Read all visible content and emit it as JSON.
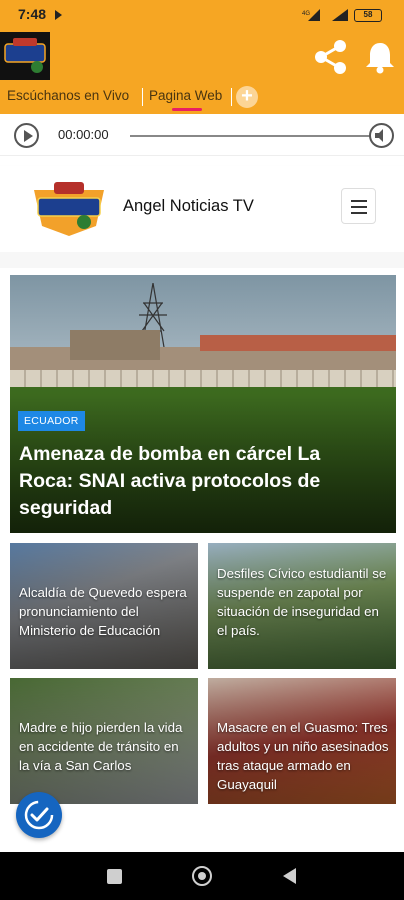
{
  "status_bar": {
    "time": "7:48",
    "battery": "58",
    "network": "4G"
  },
  "app_bar": {
    "logo_icon": "angel-noticias-logo",
    "share_icon": "share-icon",
    "bell_icon": "bell-icon"
  },
  "tabs": [
    {
      "label": "Escúchanos en Vivo"
    },
    {
      "label": "Pagina Web"
    }
  ],
  "player": {
    "time": "00:00:00"
  },
  "site": {
    "title": "Angel Noticias TV"
  },
  "hero": {
    "category": "ECUADOR",
    "headline": "Amenaza de bomba en cárcel La Roca: SNAI activa protocolos de seguridad"
  },
  "cards": [
    {
      "text": "Alcaldía de Quevedo espera pronunciamiento del Ministerio de Educación"
    },
    {
      "text": "Desfiles Cívico estudiantil se suspende en zapotal por situación de inseguridad en el país."
    },
    {
      "text": "Madre e hijo pierden la vida en accidente de tránsito en la vía a San Carlos"
    },
    {
      "text": "Masacre en el Guasmo: Tres adultos y un niño asesinados tras ataque armado en Guayaquil"
    }
  ],
  "bottom": {
    "fragment": "..."
  },
  "colors": {
    "accent": "#f6a623",
    "badge": "#1e88e5",
    "indicator": "#e91e63"
  }
}
